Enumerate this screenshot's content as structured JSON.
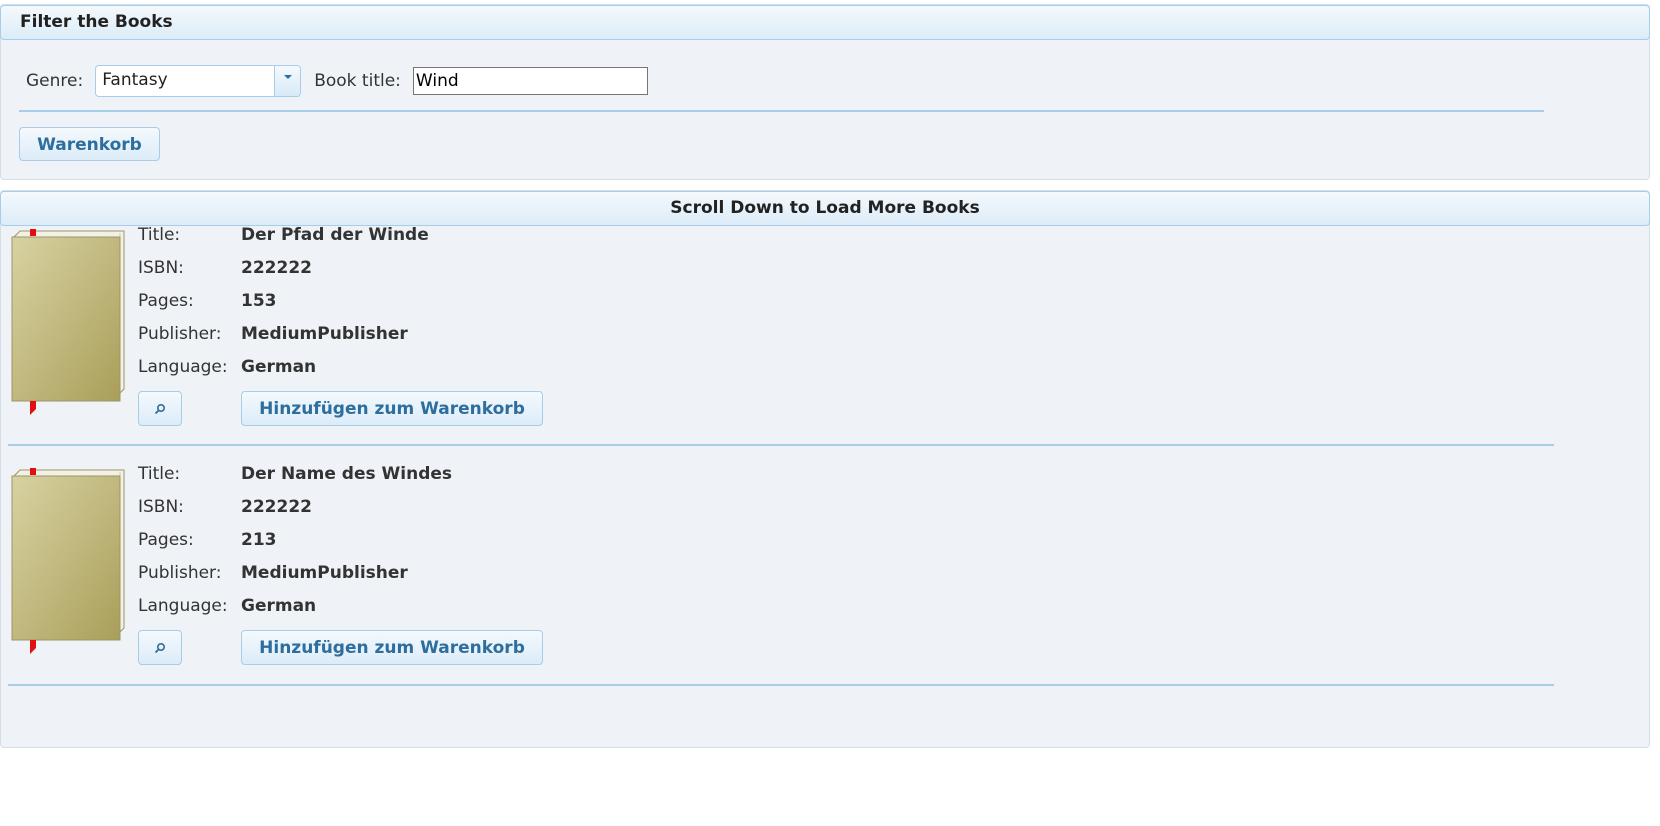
{
  "filter_panel": {
    "title": "Filter the Books",
    "genre_label": "Genre:",
    "genre_value": "Fantasy",
    "title_label": "Book title:",
    "title_value": "Wind",
    "cart_button": "Warenkorb"
  },
  "books_panel": {
    "title": "Scroll Down to Load More Books",
    "labels": {
      "title": "Title:",
      "isbn": "ISBN:",
      "pages": "Pages:",
      "publisher": "Publisher:",
      "language": "Language:"
    },
    "add_button": "Hinzufügen zum Warenkorb",
    "books": [
      {
        "title": "Der Pfad der Winde",
        "isbn": "222222",
        "pages": "153",
        "publisher": "MediumPublisher",
        "language": "German"
      },
      {
        "title": "Der Name des Windes",
        "isbn": "222222",
        "pages": "213",
        "publisher": "MediumPublisher",
        "language": "German"
      }
    ]
  },
  "icons": {
    "dropdown": "chevron-down-icon",
    "zoom": "magnifier-icon",
    "book": "book-icon"
  },
  "colors": {
    "accent": "#2e6e9e",
    "border": "#a8cde8",
    "panel_bg": "#eff3f7",
    "book_cover": "#bfb777",
    "bookmark": "#e01010"
  }
}
